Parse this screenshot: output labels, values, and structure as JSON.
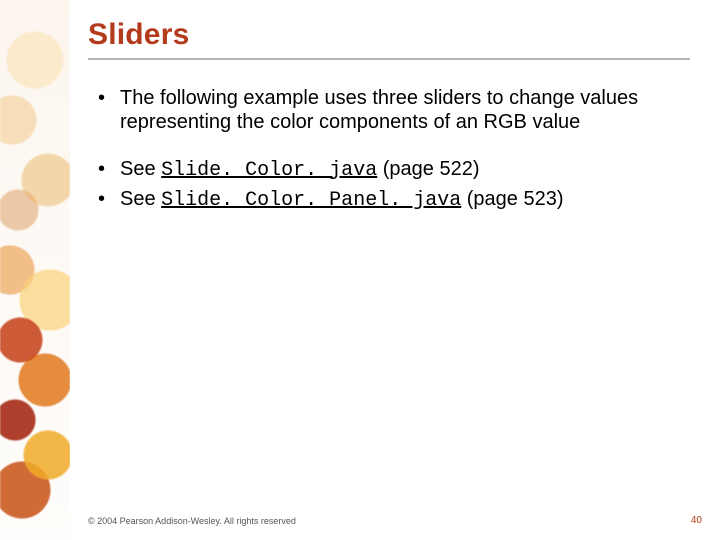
{
  "title": "Sliders",
  "bullets": {
    "b1": "The following example uses three sliders to change values representing the color components of an RGB value",
    "b2_pre": "See ",
    "b2_link": "Slide. Color. java",
    "b2_post": " (page 522)",
    "b3_pre": "See ",
    "b3_link": "Slide. Color. Panel. java",
    "b3_post": " (page 523)"
  },
  "footer": "© 2004 Pearson Addison-Wesley. All rights reserved",
  "page_number": "40"
}
